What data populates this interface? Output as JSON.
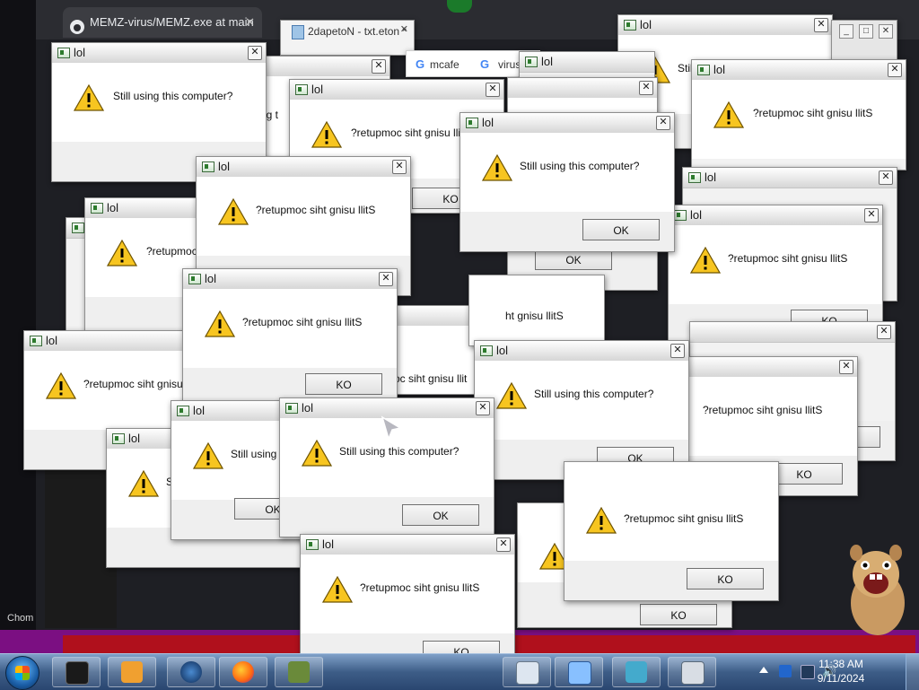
{
  "browser": {
    "tabs": [
      {
        "label": "MEMZ-virus/MEMZ.exe at main",
        "close": "✕"
      },
      {
        "label": "2dapetoN - txt.eton *",
        "close": "✕"
      },
      {
        "label": "mcafe",
        "close": ""
      },
      {
        "label": "virus",
        "close": ""
      }
    ],
    "partial_label": "Chom"
  },
  "dialog": {
    "title": "lol",
    "close_glyph": "✕",
    "message": "Still using this computer?",
    "message_reversed": "?retupmoc siht gnisu llitS",
    "ok_label": "OK",
    "ok_label_reversed": "KO",
    "partial_messages": [
      "Still using",
      "?retupmoc",
      "ng t",
      "Stil",
      "ht gnisu llitS",
      "oc siht gnisu llit",
      "S"
    ]
  },
  "taskbar": {
    "time": "11:38 AM",
    "date": "9/11/2024",
    "apps": [
      "terminal",
      "media-player",
      "app-globe",
      "firefox",
      "boxing-game",
      "notepad-doc",
      "paint-pad",
      "cube-app",
      "calculator"
    ]
  },
  "colors": {
    "taskbar": "#3d5d87",
    "dialog_body": "#ffffff",
    "warning_yellow": "#f7c520"
  }
}
